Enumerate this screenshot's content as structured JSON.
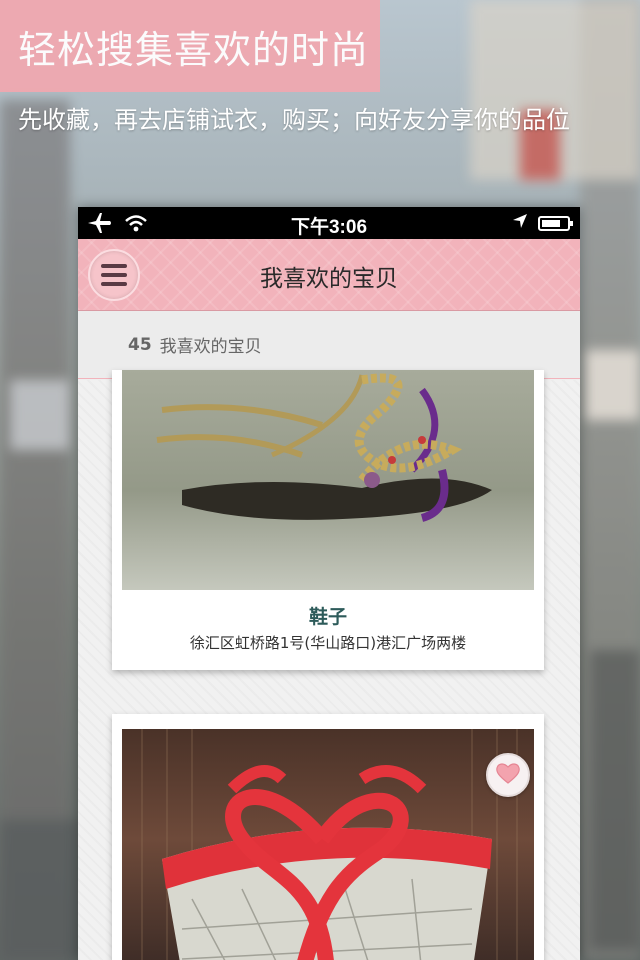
{
  "promo": {
    "headline": "轻松搜集喜欢的时尚",
    "subline": "先收藏，再去店铺试衣，购买；向好友分享你的品位"
  },
  "statusbar": {
    "time": "下午3:06",
    "icons": [
      "airplane-icon",
      "wifi-icon",
      "location-arrow-icon",
      "battery-icon"
    ]
  },
  "navbar": {
    "menu_icon": "menu-icon",
    "title": "我喜欢的宝贝"
  },
  "countbar": {
    "count": "45",
    "label": "我喜欢的宝贝"
  },
  "items": [
    {
      "image": "sandals-photo",
      "title": "鞋子",
      "address": "徐汇区虹桥路1号(华山路口)港汇广场两楼"
    },
    {
      "image": "red-heart-bag-photo",
      "like_icon": "heart-icon"
    }
  ],
  "colors": {
    "accent_pink": "#f2b3bb",
    "title_teal": "#2d5b5a"
  }
}
